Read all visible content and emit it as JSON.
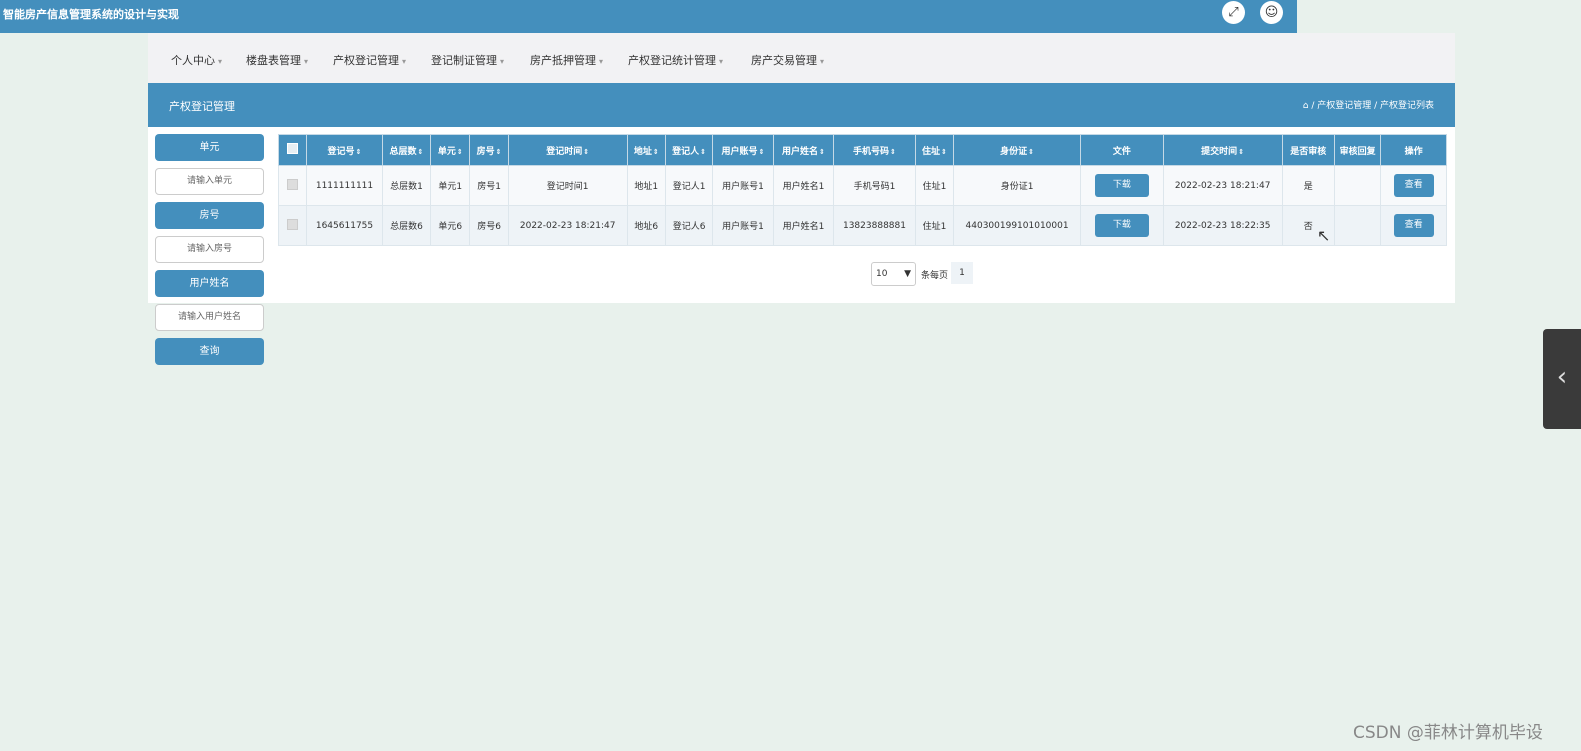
{
  "app": {
    "title": "智能房产信息管理系统的设计与实现"
  },
  "topbar_icons": {
    "expand": "expand-icon",
    "user": "user-icon"
  },
  "nav": {
    "items": [
      {
        "label": "个人中心"
      },
      {
        "label": "楼盘表管理"
      },
      {
        "label": "产权登记管理"
      },
      {
        "label": "登记制证管理"
      },
      {
        "label": "房产抵押管理"
      },
      {
        "label": "产权登记统计管理"
      },
      {
        "label": "房产交易管理"
      }
    ]
  },
  "section": {
    "title": "产权登记管理",
    "breadcrumb": "/ 产权登记管理 / 产权登记列表"
  },
  "search": {
    "unit_label": "单元",
    "unit_placeholder": "请输入单元",
    "room_label": "房号",
    "room_placeholder": "请输入房号",
    "username_label": "用户姓名",
    "username_placeholder": "请输入用户姓名",
    "query_button": "查询"
  },
  "table": {
    "columns": [
      "登记号",
      "总层数",
      "单元",
      "房号",
      "登记时间",
      "地址",
      "登记人",
      "用户账号",
      "用户姓名",
      "手机号码",
      "住址",
      "身份证",
      "文件",
      "提交时间",
      "是否审核",
      "审核回复",
      "操作"
    ],
    "rows": [
      {
        "reg_no": "1111111111",
        "floors": "总层数1",
        "unit": "单元1",
        "room": "房号1",
        "reg_time": "登记时间1",
        "address": "地址1",
        "registrant": "登记人1",
        "account": "用户账号1",
        "username": "用户姓名1",
        "phone": "手机号码1",
        "residence": "住址1",
        "id_card": "身份证1",
        "file_btn": "下载",
        "submit_time": "2022-02-23 18:21:47",
        "reviewed": "是",
        "reply": "",
        "action_btn": "查看"
      },
      {
        "reg_no": "1645611755",
        "floors": "总层数6",
        "unit": "单元6",
        "room": "房号6",
        "reg_time": "2022-02-23 18:21:47",
        "address": "地址6",
        "registrant": "登记人6",
        "account": "用户账号1",
        "username": "用户姓名1",
        "phone": "13823888881",
        "residence": "住址1",
        "id_card": "440300199101010001",
        "file_btn": "下载",
        "submit_time": "2022-02-23 18:22:35",
        "reviewed": "否",
        "reply": "",
        "action_btn": "查看"
      }
    ]
  },
  "pager": {
    "page_size": "10",
    "page_size_label": "条每页",
    "current_page": "1"
  },
  "watermark": "CSDN @菲林计算机毕设",
  "colors": {
    "primary": "#448fbd",
    "background": "#e8f1ec"
  }
}
